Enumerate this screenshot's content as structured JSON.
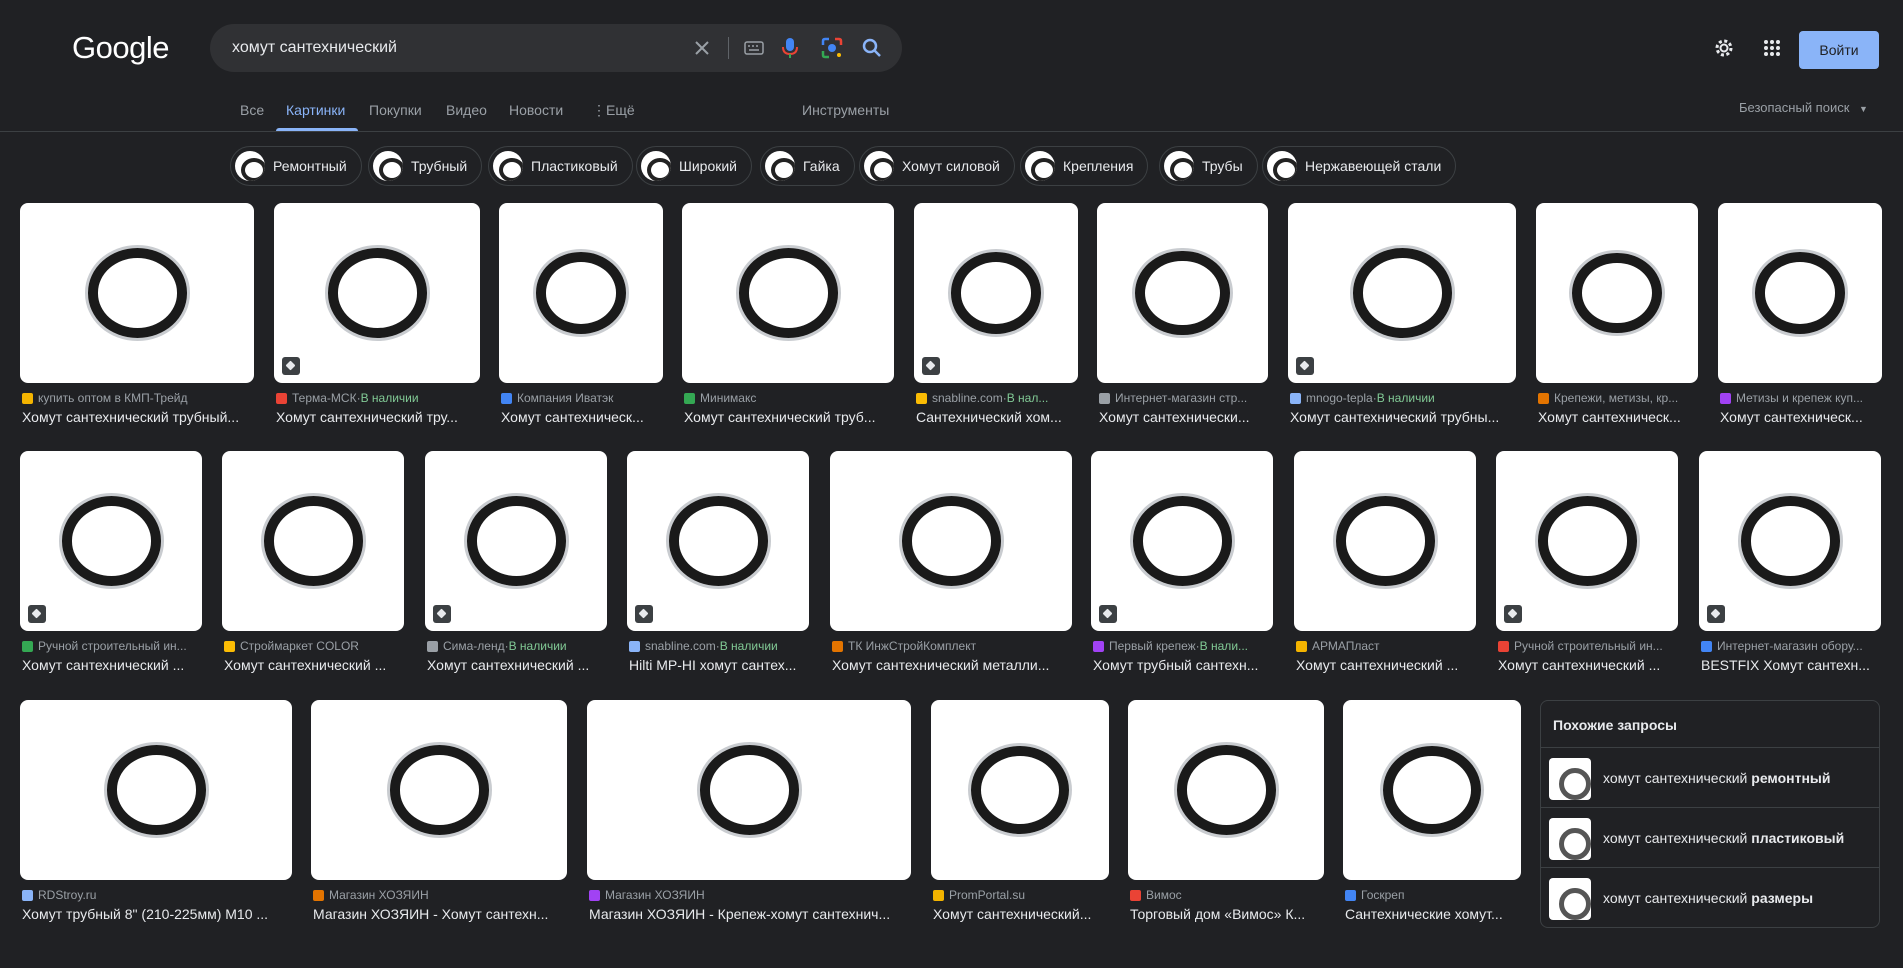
{
  "header": {
    "logo": "Google",
    "search_value": "хомут сантехнический",
    "login_label": "Войти",
    "icons": [
      "clear-icon",
      "keyboard-icon",
      "mic-icon",
      "lens-icon",
      "search-icon",
      "gear-icon",
      "apps-icon"
    ]
  },
  "tabs": {
    "all": "Все",
    "images": "Картинки",
    "shopping": "Покупки",
    "video": "Видео",
    "news": "Новости",
    "more": "Ещё",
    "tools": "Инструменты",
    "safesearch": "Безопасный поиск"
  },
  "chips": [
    "Ремонтный",
    "Трубный",
    "Пластиковый",
    "Широкий",
    "Гайка",
    "Хомут силовой",
    "Крепления",
    "Трубы",
    "Нержавеющей стали"
  ],
  "row1": [
    {
      "src": "купить оптом в КМП-Трейд",
      "avail": "",
      "title": "Хомут сантехнический трубный..."
    },
    {
      "src": "Терма-МСК",
      "avail": "В наличии",
      "title": "Хомут сантехнический тру..."
    },
    {
      "src": "Компания Иватэк",
      "avail": "",
      "title": "Хомут сантехническ..."
    },
    {
      "src": "Минимакс",
      "avail": "",
      "title": "Хомут сантехнический труб..."
    },
    {
      "src": "snabline.com",
      "avail": "В нал...",
      "title": "Сантехнический хом..."
    },
    {
      "src": "Интернет-магазин стр...",
      "avail": "",
      "title": "Хомут сантехнически..."
    },
    {
      "src": "mnogo-tepla",
      "avail": "В наличии",
      "title": "Хомут сантехнический трубны..."
    },
    {
      "src": "Крепежи, метизы, кр...",
      "avail": "",
      "title": "Хомут сантехническ..."
    },
    {
      "src": "Метизы и крепеж куп...",
      "avail": "",
      "title": "Хомут сантехническ..."
    }
  ],
  "row2": [
    {
      "src": "Ручной строительный ин...",
      "avail": "",
      "title": "Хомут сантехнический ..."
    },
    {
      "src": "Строймаркет COLOR",
      "avail": "",
      "title": "Хомут сантехнический ..."
    },
    {
      "src": "Сима-ленд",
      "avail": "В наличии",
      "title": "Хомут сантехнический ..."
    },
    {
      "src": "snabline.com",
      "avail": "В наличии",
      "title": "Hilti MP-HI хомут сантех..."
    },
    {
      "src": "ТК ИнжСтройКомплект",
      "avail": "",
      "title": "Хомут сантехнический металли..."
    },
    {
      "src": "Первый крепеж",
      "avail": "В нали...",
      "title": "Хомут трубный сантехн..."
    },
    {
      "src": "АРМАПласт",
      "avail": "",
      "title": "Хомут сантехнический ..."
    },
    {
      "src": "Ручной строительный ин...",
      "avail": "",
      "title": "Хомут сантехнический ..."
    },
    {
      "src": "Интернет-магазин обору...",
      "avail": "",
      "title": "BESTFIX Хомут сантехн..."
    }
  ],
  "row3": [
    {
      "src": "RDStroy.ru",
      "avail": "",
      "title": "Хомут трубный 8\" (210-225мм) M10 ..."
    },
    {
      "src": "Магазин ХОЗЯИН",
      "avail": "",
      "title": "Магазин ХОЗЯИН - Хомут сантехн..."
    },
    {
      "src": "Магазин ХОЗЯИН",
      "avail": "",
      "title": "Магазин ХОЗЯИН - Крепеж-хомут сантехнич..."
    },
    {
      "src": "PromPortal.su",
      "avail": "",
      "title": "Хомут сантехнический..."
    },
    {
      "src": "Вимос",
      "avail": "",
      "title": "Торговый дом «Вимос» К..."
    },
    {
      "src": "Госкреп",
      "avail": "",
      "title": "Сантехнические хомут..."
    }
  ],
  "related": {
    "title": "Похожие запросы",
    "items": [
      {
        "prefix": "хомут сантехнический ",
        "bold": "ремонтный"
      },
      {
        "prefix": "хомут сантехнический ",
        "bold": "пластиковый"
      },
      {
        "prefix": "хомут сантехнический ",
        "bold": "размеры"
      }
    ]
  },
  "colors": {
    "accent": "#8ab4f8",
    "available": "#81c995",
    "background": "#202124"
  }
}
